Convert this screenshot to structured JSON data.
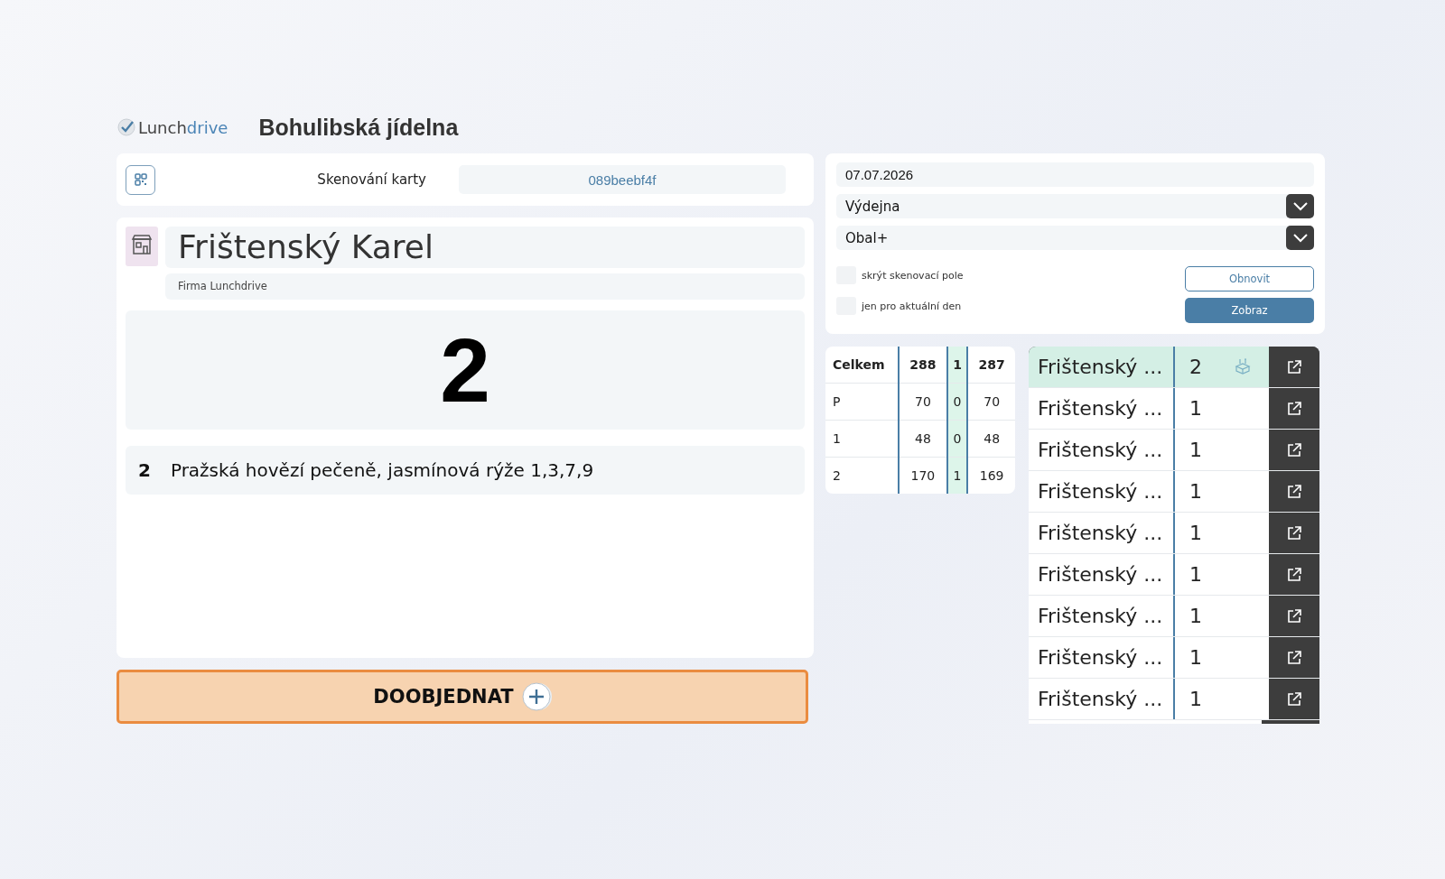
{
  "header": {
    "logo_prefix": "Lunch",
    "logo_suffix": "drive",
    "title": "Bohulibská jídelna"
  },
  "scan": {
    "label": "Skenování karty",
    "value": "089beebf4f"
  },
  "customer": {
    "name": "Frištenský Karel",
    "company": "Firma Lunchdrive",
    "portions": "2"
  },
  "meal": {
    "number": "2",
    "name": "Pražská hovězí pečeně, jasmínová rýže 1,3,7,9"
  },
  "order_button": {
    "label": "DOOBJEDNAT"
  },
  "filters": {
    "date": "07.07.2026",
    "selects": [
      {
        "value": "Výdejna"
      },
      {
        "value": "Obal+"
      }
    ],
    "checkboxes": [
      {
        "label": "skrýt skenovací pole",
        "checked": false
      },
      {
        "label": "jen pro aktuální den",
        "checked": false
      }
    ],
    "buttons": [
      {
        "label": "Obnovit",
        "kind": "outline"
      },
      {
        "label": "Zobraz",
        "kind": "primary"
      }
    ]
  },
  "summary": {
    "rows": [
      [
        "Celkem",
        "288",
        "1",
        "287"
      ],
      [
        "P",
        "70",
        "0",
        "70"
      ],
      [
        "1",
        "48",
        "0",
        "48"
      ],
      [
        "2",
        "170",
        "1",
        "169"
      ]
    ]
  },
  "list": [
    {
      "name": "Frištenský ...",
      "count": "2",
      "selected": true,
      "packaged": true
    },
    {
      "name": "Frištenský ...",
      "count": "1",
      "selected": false,
      "packaged": false
    },
    {
      "name": "Frištenský ...",
      "count": "1",
      "selected": false,
      "packaged": false
    },
    {
      "name": "Frištenský ...",
      "count": "1",
      "selected": false,
      "packaged": false
    },
    {
      "name": "Frištenský ...",
      "count": "1",
      "selected": false,
      "packaged": false
    },
    {
      "name": "Frištenský ...",
      "count": "1",
      "selected": false,
      "packaged": false
    },
    {
      "name": "Frištenský ...",
      "count": "1",
      "selected": false,
      "packaged": false
    },
    {
      "name": "Frištenský ...",
      "count": "1",
      "selected": false,
      "packaged": false
    },
    {
      "name": "Frištenský ...",
      "count": "1",
      "selected": false,
      "packaged": false
    }
  ]
}
